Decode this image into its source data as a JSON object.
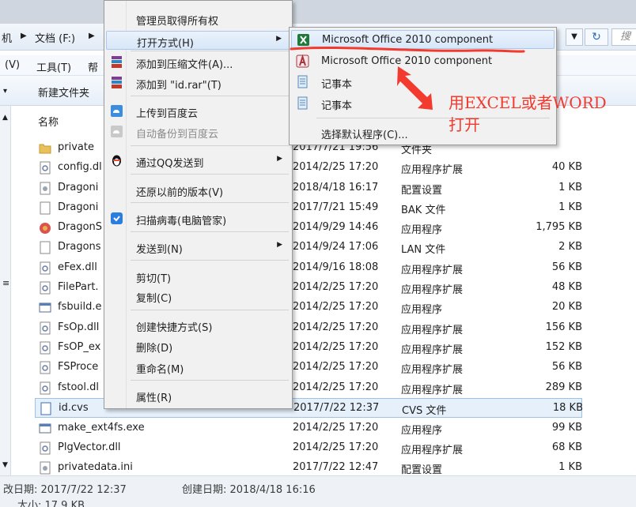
{
  "addressbar": {
    "crumb_part1": "机",
    "crumb_part2": "文档 (F:)",
    "search_placeholder": "搜"
  },
  "menubar": {
    "view": "(V)",
    "tools": "工具(T)",
    "help": "帮"
  },
  "toolbar": {
    "new_folder": "新建文件夹"
  },
  "column_header": {
    "name": "名称"
  },
  "files": [
    {
      "name": "private",
      "date": "2017/7/21 19:56",
      "type": "文件夹",
      "size": "",
      "icon": "folder-icon"
    },
    {
      "name": "config.dl",
      "date": "2014/2/25 17:20",
      "type": "应用程序扩展",
      "size": "40 KB",
      "icon": "dll-icon"
    },
    {
      "name": "Dragoni",
      "date": "2018/4/18 16:17",
      "type": "配置设置",
      "size": "1 KB",
      "icon": "ini-icon"
    },
    {
      "name": "Dragoni",
      "date": "2017/7/21 15:49",
      "type": "BAK 文件",
      "size": "1 KB",
      "icon": "blank-file-icon"
    },
    {
      "name": "DragonS",
      "date": "2014/9/29 14:46",
      "type": "应用程序",
      "size": "1,795 KB",
      "icon": "app-icon"
    },
    {
      "name": "Dragons",
      "date": "2014/9/24 17:06",
      "type": "LAN 文件",
      "size": "2 KB",
      "icon": "blank-file-icon"
    },
    {
      "name": "eFex.dll",
      "date": "2014/9/16 18:08",
      "type": "应用程序扩展",
      "size": "56 KB",
      "icon": "dll-icon"
    },
    {
      "name": "FilePart.",
      "date": "2014/2/25 17:20",
      "type": "应用程序扩展",
      "size": "48 KB",
      "icon": "dll-icon"
    },
    {
      "name": "fsbuild.e",
      "date": "2014/2/25 17:20",
      "type": "应用程序",
      "size": "20 KB",
      "icon": "exe-icon"
    },
    {
      "name": "FsOp.dll",
      "date": "2014/2/25 17:20",
      "type": "应用程序扩展",
      "size": "156 KB",
      "icon": "dll-icon"
    },
    {
      "name": "FsOP_ex",
      "date": "2014/2/25 17:20",
      "type": "应用程序扩展",
      "size": "152 KB",
      "icon": "dll-icon"
    },
    {
      "name": "FSProce",
      "date": "2014/2/25 17:20",
      "type": "应用程序扩展",
      "size": "56 KB",
      "icon": "dll-icon"
    },
    {
      "name": "fstool.dl",
      "date": "2014/2/25 17:20",
      "type": "应用程序扩展",
      "size": "289 KB",
      "icon": "dll-icon"
    },
    {
      "name": "id.cvs",
      "date": "2017/7/22 12:37",
      "type": "CVS 文件",
      "size": "18 KB",
      "icon": "blank-file-icon"
    },
    {
      "name": "make_ext4fs.exe",
      "date": "2014/2/25 17:20",
      "type": "应用程序",
      "size": "99 KB",
      "icon": "exe-icon"
    },
    {
      "name": "PlgVector.dll",
      "date": "2014/2/25 17:20",
      "type": "应用程序扩展",
      "size": "68 KB",
      "icon": "dll-icon"
    },
    {
      "name": "privatedata.ini",
      "date": "2017/7/22 12:47",
      "type": "配置设置",
      "size": "1 KB",
      "icon": "ini-icon"
    }
  ],
  "status": {
    "modified": "改日期: 2017/7/22 12:37",
    "created": "创建日期: 2018/4/18 16:16",
    "size": "大小: 17.9 KB"
  },
  "context_menu": {
    "take_ownership": "管理员取得所有权",
    "open_with": "打开方式(H)",
    "add_archive": "添加到压缩文件(A)...",
    "add_rar": "添加到 \"id.rar\"(T)",
    "upload_baidu": "上传到百度云",
    "auto_backup_baidu": "自动备份到百度云",
    "send_qq": "通过QQ发送到",
    "restore_prev": "还原以前的版本(V)",
    "scan_virus": "扫描病毒(电脑管家)",
    "send_to": "发送到(N)",
    "cut": "剪切(T)",
    "copy": "复制(C)",
    "create_shortcut": "创建快捷方式(S)",
    "delete": "删除(D)",
    "rename": "重命名(M)",
    "properties": "属性(R)"
  },
  "open_with_menu": {
    "excel": "Microsoft Office 2010 component",
    "access": "Microsoft Office 2010 component",
    "notepad1": "记事本",
    "notepad2": "记事本",
    "choose_default": "选择默认程序(C)..."
  },
  "annotation": {
    "line1": "用EXCEL或者WORD",
    "line2": "打开",
    "color": "#f23a2f"
  }
}
